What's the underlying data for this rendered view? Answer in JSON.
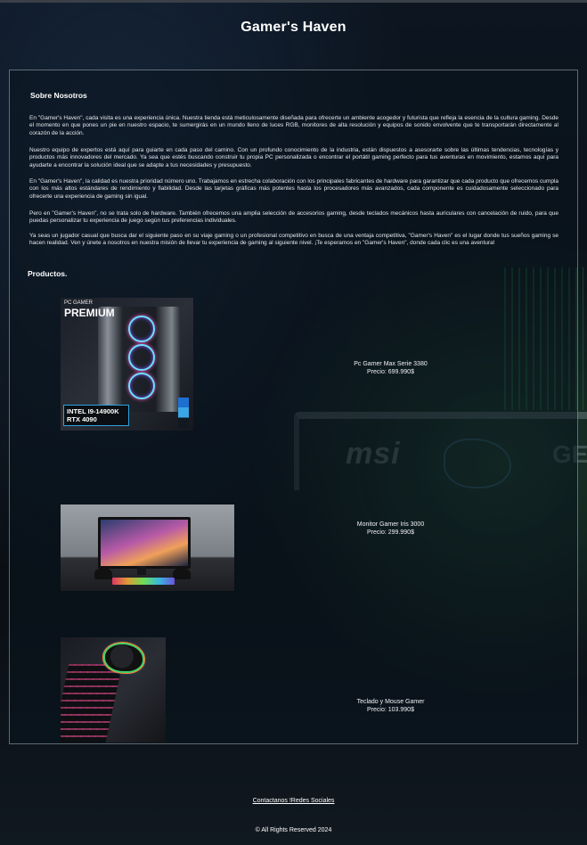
{
  "header": {
    "title": "Gamer's Haven"
  },
  "about": {
    "title": "Sobre Nosotros",
    "paragraphs": [
      "En \"Gamer's Haven\", cada visita es una experiencia única. Nuestra tienda está meticulosamente diseñada para ofrecerte un ambiente acogedor y futurista que refleja la esencia de la cultura gaming. Desde el momento en que pones un pie en nuestro espacio, te sumergirás en un mundo lleno de luces RGB, monitores de alta resolución y equipos de sonido envolvente que te transportarán directamente al corazón de la acción.",
      "Nuestro equipo de expertos está aquí para guiarte en cada paso del camino. Con un profundo conocimiento de la industria, están dispuestos a asesorarte sobre las últimas tendencias, tecnologías y productos más innovadores del mercado. Ya sea que estés buscando construir tu propia PC personalizada o encontrar el portátil gaming perfecto para tus aventuras en movimiento, estamos aquí para ayudarte a encontrar la solución ideal que se adapte a tus necesidades y presupuesto.",
      "En \"Gamer's Haven\", la calidad es nuestra prioridad número uno. Trabajamos en estrecha colaboración con los principales fabricantes de hardware para garantizar que cada producto que ofrecemos cumpla con los más altos estándares de rendimiento y fiabilidad. Desde las tarjetas gráficas más potentes hasta los procesadores más avanzados, cada componente es cuidadosamente seleccionado para ofrecerte una experiencia de gaming sin igual.",
      "Pero en \"Gamer's Haven\", no se trata solo de hardware. También ofrecemos una amplia selección de accesorios gaming, desde teclados mecánicos hasta auriculares con cancelación de ruido, para que puedas personalizar tu experiencia de juego según tus preferencias individuales.",
      "Ya seas un jugador casual que busca dar el siguiente paso en su viaje gaming o un profesional competitivo en busca de una ventaja competitiva, \"Gamer's Haven\" es el lugar donde tus sueños gaming se hacen realidad. Ven y únete a nosotros en nuestra misión de llevar tu experiencia de gaming al siguiente nivel. ¡Te esperamos en \"Gamer's Haven\", donde cada clic es una aventura!"
    ]
  },
  "products": {
    "title": "Productos.",
    "items": [
      {
        "name": "Pc Gamer Max Serie 3380",
        "price": "Precio: 699.990$",
        "image": {
          "label_small": "PC GAMER",
          "label_big": "PREMIUM",
          "spec_line1": "INTEL I9-14900K",
          "spec_line2": "RTX 4090"
        }
      },
      {
        "name": "Monitor Gamer Iris 3000",
        "price": "Precio: 299.990$"
      },
      {
        "name": "Teclado y Mouse Gamer",
        "price": "Precio: 103.990$"
      }
    ]
  },
  "background": {
    "brand_text": "msi",
    "partial_text": "GE"
  },
  "footer": {
    "link_label": "Contactanos !Redes Sociales",
    "copyright": "© All Rights Reserved 2024"
  }
}
